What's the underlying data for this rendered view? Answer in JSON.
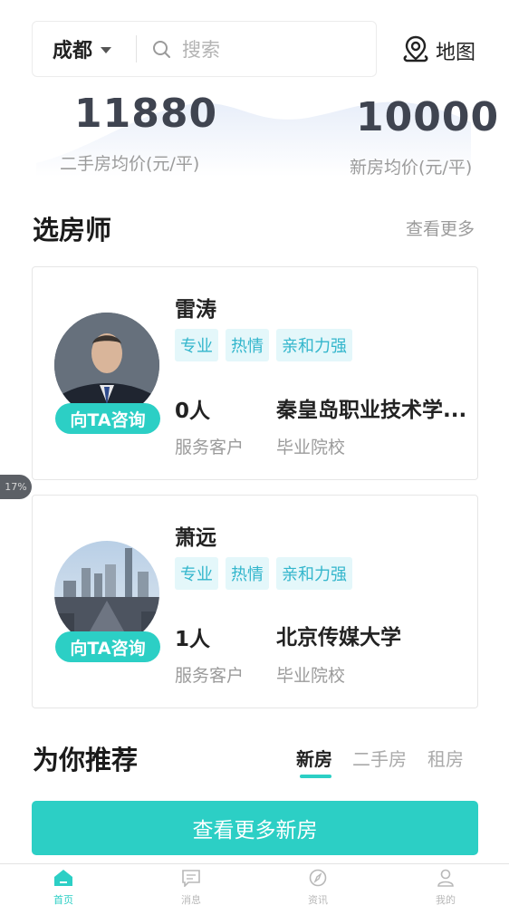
{
  "search": {
    "city": "成都",
    "placeholder": "搜索",
    "map_label": "地图"
  },
  "prices": {
    "second_hand": {
      "value": "11880",
      "label": "二手房均价(元/平)"
    },
    "new_house": {
      "value": "10000",
      "label": "新房均价(元/平)"
    }
  },
  "agents_section": {
    "title": "选房师",
    "see_more": "查看更多",
    "agents": [
      {
        "name": "雷涛",
        "tags": [
          "专业",
          "热情",
          "亲和力强"
        ],
        "customers_value": "0人",
        "customers_label": "服务客户",
        "school_value": "秦皇岛职业技术学...",
        "school_label": "毕业院校",
        "consult_label": "向TA咨询"
      },
      {
        "name": "萧远",
        "tags": [
          "专业",
          "热情",
          "亲和力强"
        ],
        "customers_value": "1人",
        "customers_label": "服务客户",
        "school_value": "北京传媒大学",
        "school_label": "毕业院校",
        "consult_label": "向TA咨询"
      }
    ]
  },
  "scroll_badge": "17%",
  "recommend": {
    "title": "为你推荐",
    "tabs": [
      "新房",
      "二手房",
      "租房"
    ],
    "active_tab": "新房",
    "button_label": "查看更多新房"
  },
  "bottom_nav": [
    {
      "label": "首页",
      "icon": "home-icon",
      "active": true
    },
    {
      "label": "消息",
      "icon": "message-icon",
      "active": false
    },
    {
      "label": "资讯",
      "icon": "compass-icon",
      "active": false
    },
    {
      "label": "我的",
      "icon": "user-icon",
      "active": false
    }
  ],
  "colors": {
    "accent": "#2ccfc5",
    "tag_bg": "#e4f7fa",
    "tag_text": "#33b6cc",
    "price_text": "#3f4450"
  }
}
